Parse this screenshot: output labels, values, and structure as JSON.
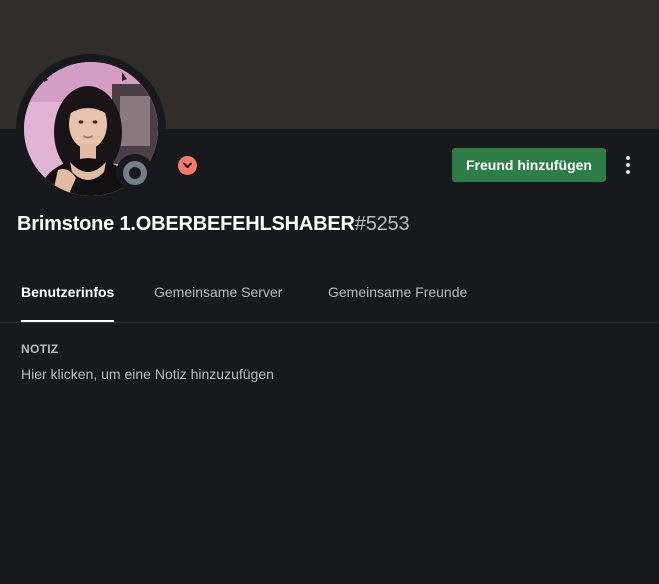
{
  "profile": {
    "username": "Brimstone 1.OBERBEFEHLSHABER",
    "discriminator": "#5253",
    "status": "offline",
    "avatar_icon": "avatar-photo",
    "badge_icon": "chevron-down-icon"
  },
  "actions": {
    "add_friend_label": "Freund hinzufügen",
    "more_icon": "more-vertical-icon"
  },
  "tabs": [
    {
      "label": "Benutzerinfos",
      "active": true
    },
    {
      "label": "Gemeinsame Server",
      "active": false
    },
    {
      "label": "Gemeinsame Freunde",
      "active": false
    }
  ],
  "note": {
    "title": "NOTIZ",
    "placeholder": "Hier klicken, um eine Notiz hinzuzufügen"
  },
  "colors": {
    "background": "#18191c",
    "banner": "#312d2a",
    "add_friend_button": "#2d7d46",
    "badge": "#f47b67",
    "status_offline": "#747f8d"
  }
}
